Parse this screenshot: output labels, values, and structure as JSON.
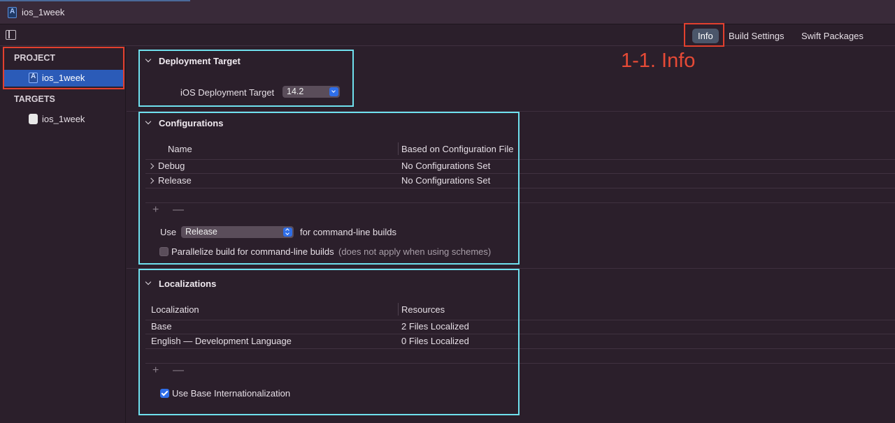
{
  "window": {
    "title": "ios_1week"
  },
  "toolbar": {
    "tabs": [
      "Info",
      "Build Settings",
      "Swift Packages"
    ],
    "selected_tab": "Info"
  },
  "annotation": {
    "label": "1-1. Info"
  },
  "sidebar": {
    "project_header": "PROJECT",
    "project_item": "ios_1week",
    "targets_header": "TARGETS",
    "target_item": "ios_1week"
  },
  "deployment": {
    "title": "Deployment Target",
    "label": "iOS Deployment Target",
    "value": "14.2"
  },
  "configurations": {
    "title": "Configurations",
    "columns": [
      "Name",
      "Based on Configuration File"
    ],
    "rows": [
      {
        "name": "Debug",
        "file": "No Configurations Set"
      },
      {
        "name": "Release",
        "file": "No Configurations Set"
      }
    ],
    "add": "+",
    "remove": "—",
    "use_label": "Use",
    "use_value": "Release",
    "use_suffix": "for command-line builds",
    "parallelize_label": "Parallelize build for command-line builds",
    "parallelize_note": "(does not apply when using schemes)",
    "parallelize_checked": false
  },
  "localizations": {
    "title": "Localizations",
    "columns": [
      "Localization",
      "Resources"
    ],
    "rows": [
      {
        "name": "Base",
        "resources": "2 Files Localized"
      },
      {
        "name": "English — Development Language",
        "resources": "0 Files Localized"
      }
    ],
    "add": "+",
    "remove": "—",
    "base_intl_label": "Use Base Internationalization",
    "base_intl_checked": true
  },
  "colors": {
    "background": "#2b1f2b",
    "selection": "#2b5bb8",
    "annotation_red": "#e2402e",
    "highlight_cyan": "#6fe0ee",
    "accent_blue": "#2f6ee8"
  }
}
